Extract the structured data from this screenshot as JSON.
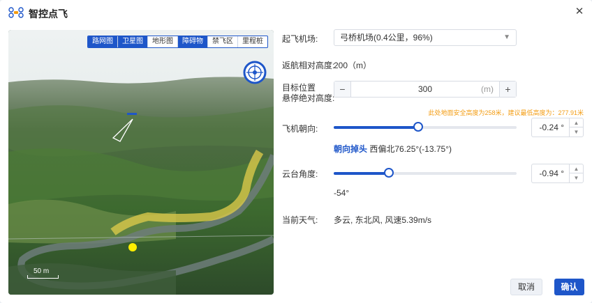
{
  "header": {
    "title": "智控点飞"
  },
  "map": {
    "layers": [
      "路网图",
      "卫星图",
      "地形图",
      "障碍物",
      "禁飞区",
      "里程桩"
    ],
    "active_layers": [
      "路网图",
      "卫星图",
      "障碍物"
    ],
    "scale_label": "50 m"
  },
  "form": {
    "takeoff_label": "起飞机场:",
    "takeoff_value": "弓桥机场(0.4公里，96%)",
    "return_label": "返航相对高度:",
    "return_value": "200（m）",
    "target_label_1": "目标位置",
    "target_label_2": "悬停绝对高度:",
    "target_value": "300",
    "target_unit": "(m)",
    "target_minus": "−",
    "target_plus": "+",
    "warning": "此处地面安全高度为258米，建议最低高度为：277.91米",
    "heading_label": "飞机朝向:",
    "heading_value": "-0.24 °",
    "heading_fraction": 0.46,
    "heading_link": "朝向掉头",
    "heading_desc": "西偏北76.25°(-13.75°)",
    "gimbal_label": "云台角度:",
    "gimbal_value": "-0.94 °",
    "gimbal_fraction": 0.3,
    "gimbal_desc": "-54°",
    "weather_label": "当前天气:",
    "weather_value": "多云, 东北风, 风速5.39m/s"
  },
  "buttons": {
    "cancel": "取消",
    "confirm": "确认"
  },
  "colors": {
    "accent": "#1e56c9",
    "warning": "#f39c12"
  },
  "icons": {
    "close": "close-icon",
    "app": "drone-icon",
    "compass": "compass-icon",
    "chevron": "chevron-down-icon"
  }
}
